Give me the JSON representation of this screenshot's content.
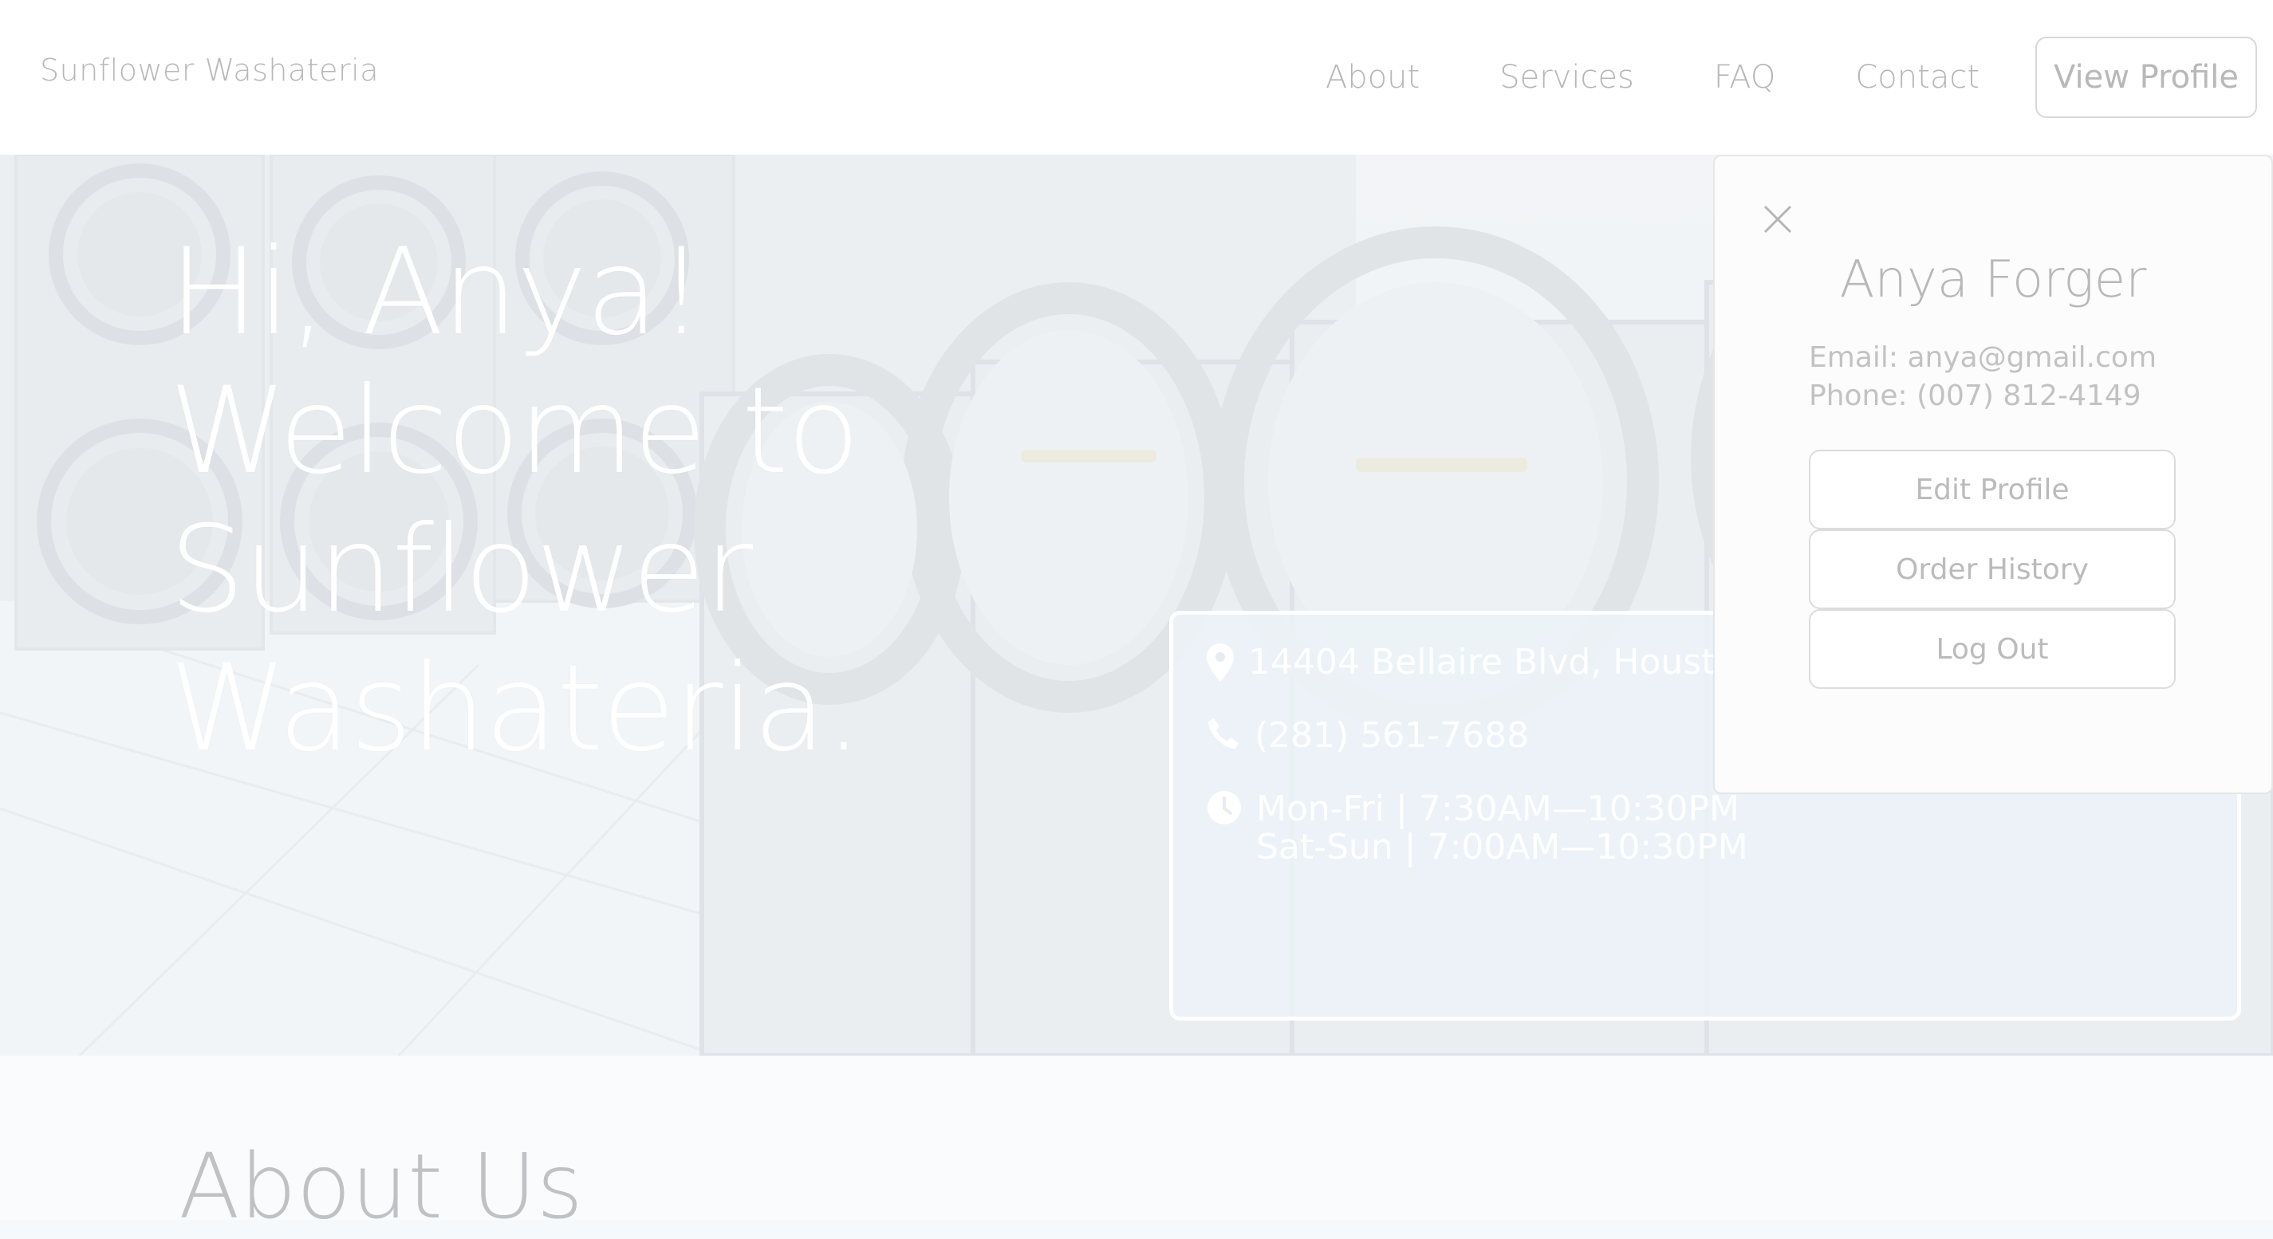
{
  "nav": {
    "brand": "Sunflower Washateria",
    "links": [
      "About",
      "Services",
      "FAQ",
      "Contact"
    ],
    "view_profile": "View Profile"
  },
  "hero": {
    "title_lines": [
      "Hi, Anya!",
      "Welcome to",
      "Sunflower",
      "Washateria."
    ],
    "address": "14404 Bellaire Blvd, Houston,",
    "phone": "(281) 561-7688",
    "hours": [
      "Mon-Fri | 7:30AM—10:30PM",
      "Sat-Sun | 7:00AM—10:30PM"
    ]
  },
  "about": {
    "title": "About Us"
  },
  "profile": {
    "name": "Anya Forger",
    "email": "Email: anya@gmail.com",
    "phone": "Phone: (007) 812-4149",
    "buttons": [
      "Edit Profile",
      "Order History",
      "Log Out"
    ]
  },
  "icons": {
    "address": "map-pin-icon",
    "phone": "phone-icon",
    "hours": "clock-icon",
    "close": "close-icon"
  },
  "colors": {
    "hero_text": "#ffffff",
    "muted_text": "#b8b8b8",
    "panel_bg": "#fcfcfc"
  }
}
